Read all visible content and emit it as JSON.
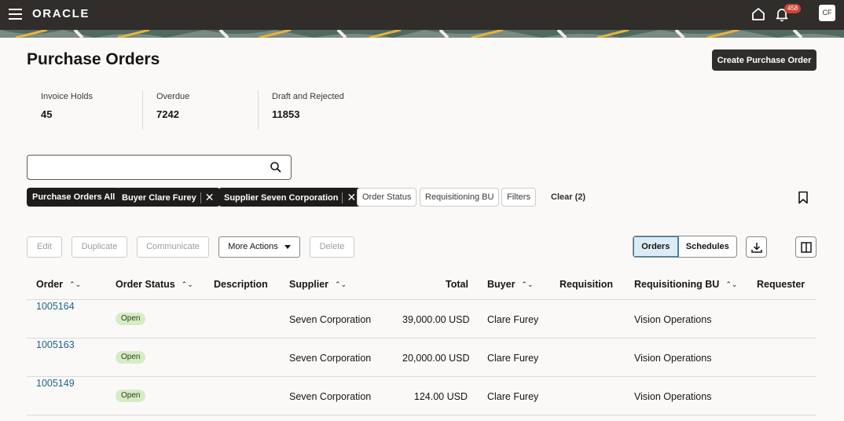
{
  "header": {
    "brand": "ORACLE",
    "notification_count": "458",
    "avatar_initials": "CF"
  },
  "page": {
    "title": "Purchase Orders",
    "create_button": "Create Purchase Order"
  },
  "metrics": [
    {
      "label": "Invoice Holds",
      "value": "45"
    },
    {
      "label": "Overdue",
      "value": "7242"
    },
    {
      "label": "Draft and Rejected",
      "value": "11853"
    }
  ],
  "search": {
    "value": "",
    "placeholder": ""
  },
  "filters": {
    "chips": [
      {
        "label": "Purchase Orders All"
      },
      {
        "label": "Buyer Clare Furey"
      },
      {
        "label": "Supplier Seven Corporation"
      },
      {
        "label": "Order Status"
      },
      {
        "label": "Requisitioning BU"
      },
      {
        "label": "Filters"
      }
    ],
    "clear": "Clear (2)"
  },
  "actions": {
    "edit": "Edit",
    "duplicate": "Duplicate",
    "communicate": "Communicate",
    "more": "More Actions",
    "delete": "Delete",
    "view_orders": "Orders",
    "view_schedules": "Schedules"
  },
  "table": {
    "columns": [
      "Order",
      "Order Status",
      "Description",
      "Supplier",
      "Total",
      "Buyer",
      "Requisition",
      "Requisitioning BU",
      "Requester"
    ],
    "rows": [
      {
        "order": "1005164",
        "status": "Open",
        "description": "",
        "supplier": "Seven Corporation",
        "total": "39,000.00 USD",
        "buyer": "Clare Furey",
        "requisition": "",
        "bu": "Vision Operations",
        "requester": ""
      },
      {
        "order": "1005163",
        "status": "Open",
        "description": "",
        "supplier": "Seven Corporation",
        "total": "20,000.00 USD",
        "buyer": "Clare Furey",
        "requisition": "",
        "bu": "Vision Operations",
        "requester": ""
      },
      {
        "order": "1005149",
        "status": "Open",
        "description": "",
        "supplier": "Seven Corporation",
        "total": "124.00 USD",
        "buyer": "Clare Furey",
        "requisition": "",
        "bu": "Vision Operations",
        "requester": ""
      }
    ]
  },
  "colors": {
    "topbar": "#312d2a",
    "link": "#21648f",
    "status_open_bg": "#d6ecc3",
    "badge": "#c74634"
  }
}
